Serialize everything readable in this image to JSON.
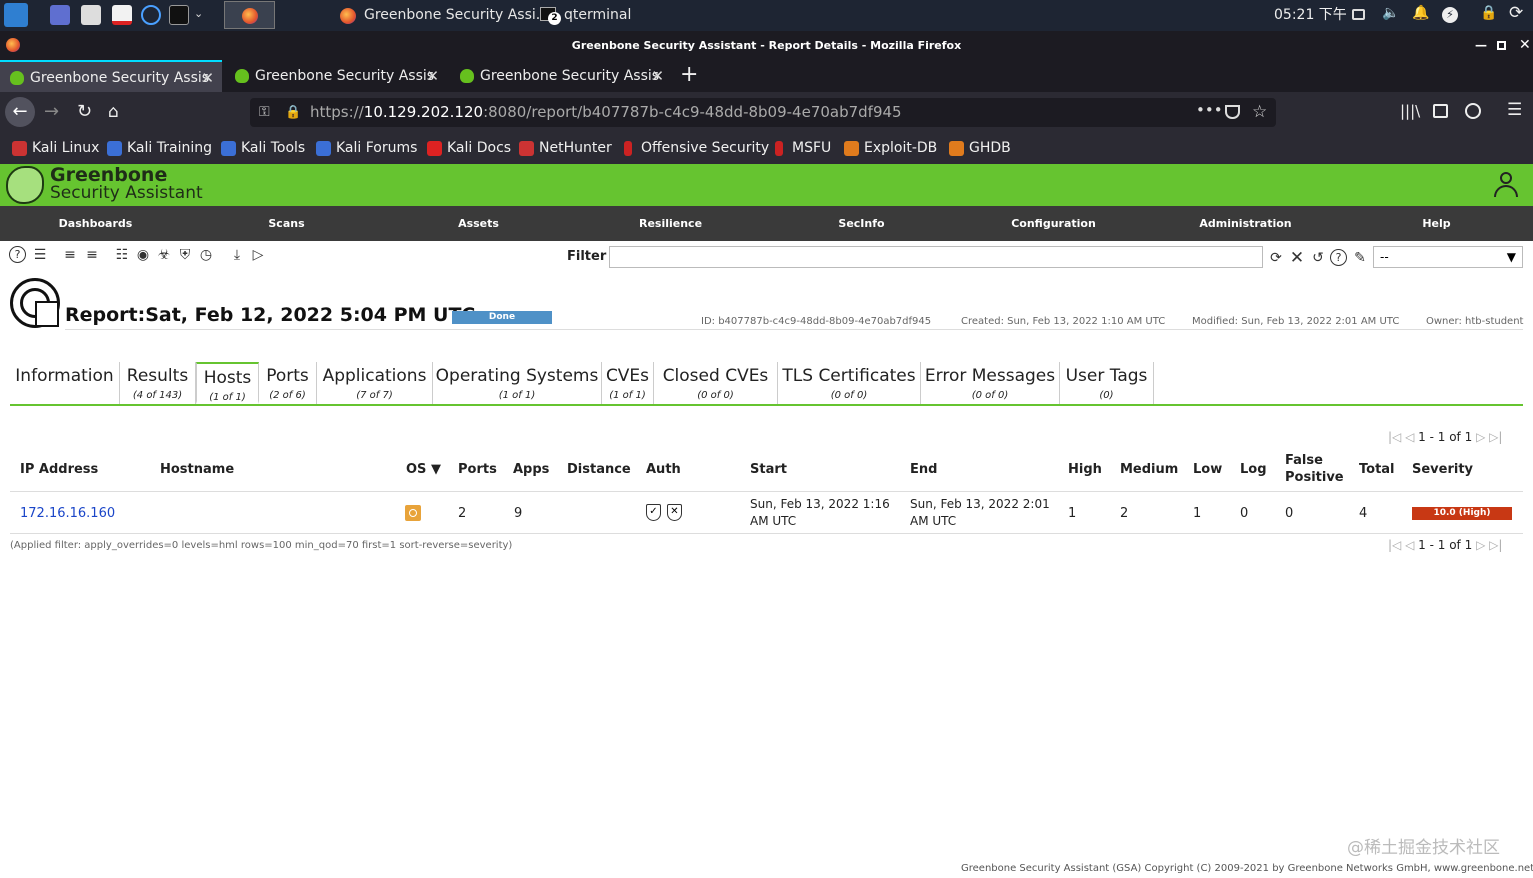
{
  "taskbar": {
    "tasks": [
      {
        "label": "Greenbone Security Assi..."
      },
      {
        "label": "qterminal"
      }
    ],
    "clock": "05:21 下午",
    "terminal_badge": "2"
  },
  "window": {
    "title": "Greenbone Security Assistant - Report Details - Mozilla Firefox"
  },
  "browser": {
    "tabs": [
      {
        "label": "Greenbone Security Assis"
      },
      {
        "label": "Greenbone Security Assis"
      },
      {
        "label": "Greenbone Security Assis"
      }
    ],
    "url_prefix": "https://",
    "url_host": "10.129.202.120",
    "url_rest": ":8080/report/b407787b-c4c9-48dd-8b09-4e70ab7df945",
    "bookmarks": [
      "Kali Linux",
      "Kali Training",
      "Kali Tools",
      "Kali Forums",
      "Kali Docs",
      "NetHunter",
      "Offensive Security",
      "MSFU",
      "Exploit-DB",
      "GHDB"
    ]
  },
  "gsa": {
    "logo_line1": "Greenbone",
    "logo_line2": "Security Assistant",
    "menu": [
      "Dashboards",
      "Scans",
      "Assets",
      "Resilience",
      "SecInfo",
      "Configuration",
      "Administration",
      "Help"
    ],
    "filter_label": "Filter",
    "filter_value": "",
    "filter_select": "--"
  },
  "report": {
    "title": "Report:Sat, Feb 12, 2022 5:04 PM UTC",
    "status": "Done",
    "status_progress_pct": 100,
    "id": "ID: b407787b-c4c9-48dd-8b09-4e70ab7df945",
    "created": "Created: Sun, Feb 13, 2022 1:10 AM UTC",
    "modified": "Modified: Sun, Feb 13, 2022 2:01 AM UTC",
    "owner": "Owner: htb-student"
  },
  "tabs": [
    {
      "title": "Information",
      "count": ""
    },
    {
      "title": "Results",
      "count": "(4 of 143)"
    },
    {
      "title": "Hosts",
      "count": "(1 of 1)"
    },
    {
      "title": "Ports",
      "count": "(2 of 6)"
    },
    {
      "title": "Applications",
      "count": "(7 of 7)"
    },
    {
      "title": "Operating Systems",
      "count": "(1 of 1)"
    },
    {
      "title": "CVEs",
      "count": "(1 of 1)"
    },
    {
      "title": "Closed CVEs",
      "count": "(0 of 0)"
    },
    {
      "title": "TLS Certificates",
      "count": "(0 of 0)"
    },
    {
      "title": "Error Messages",
      "count": "(0 of 0)"
    },
    {
      "title": "User Tags",
      "count": "(0)"
    }
  ],
  "pager": {
    "text": "1 - 1 of 1"
  },
  "table": {
    "headers": {
      "ip": "IP Address",
      "hostname": "Hostname",
      "os": "OS ▼",
      "ports": "Ports",
      "apps": "Apps",
      "distance": "Distance",
      "auth": "Auth",
      "start": "Start",
      "end": "End",
      "high": "High",
      "medium": "Medium",
      "low": "Low",
      "log": "Log",
      "false_positive_1": "False",
      "false_positive_2": "Positive",
      "total": "Total",
      "severity": "Severity"
    },
    "row": {
      "ip": "172.16.16.160",
      "hostname": "",
      "ports": "2",
      "apps": "9",
      "distance": "",
      "start_1": "Sun, Feb 13, 2022 1:16",
      "start_2": "AM UTC",
      "end_1": "Sun, Feb 13, 2022 2:01",
      "end_2": "AM UTC",
      "high": "1",
      "medium": "2",
      "low": "1",
      "log": "0",
      "false_positive": "0",
      "total": "4",
      "severity": "10.0 (High)"
    },
    "applied_filter": "(Applied filter: apply_overrides=0 levels=hml rows=100 min_qod=70 first=1 sort-reverse=severity)"
  },
  "watermark": "@稀土掘金技术社区",
  "footer": "Greenbone Security Assistant (GSA) Copyright (C) 2009-2021 by Greenbone Networks GmbH, www.greenbone.net",
  "colors": {
    "green": "#66c430",
    "severity_high": "#c83814",
    "status_done": "#4f91c7"
  }
}
